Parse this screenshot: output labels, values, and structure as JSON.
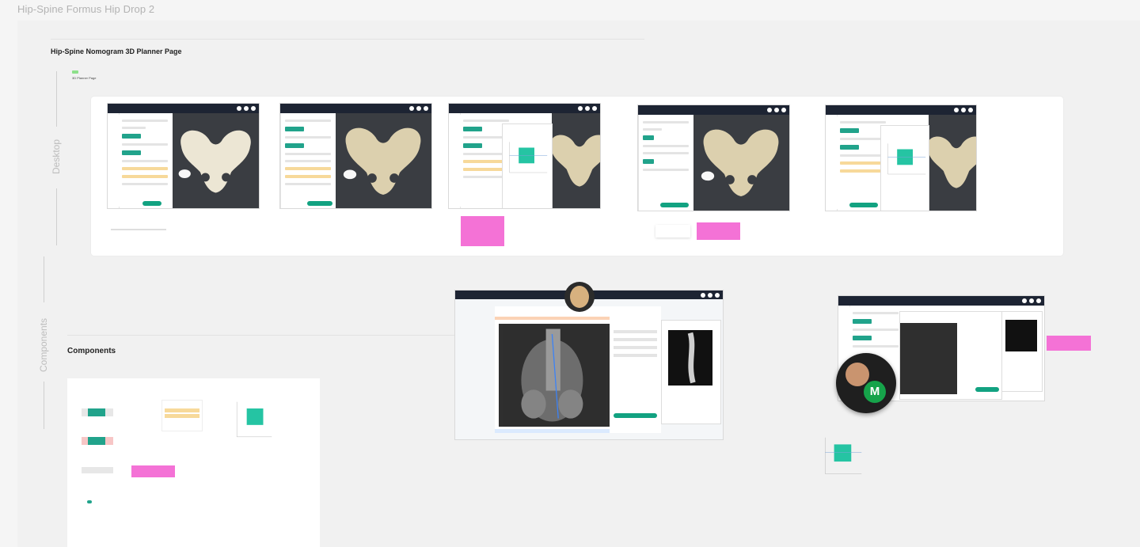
{
  "file": {
    "title": "Hip-Spine Formus Hip Drop 2"
  },
  "sections": {
    "main_heading": "Hip-Spine Nomogram 3D Planner Page",
    "tag_badge": "",
    "tag_label": "3D Planner Page",
    "desktop_label": "Desktop",
    "components_side_label": "Components",
    "components_heading": "Components"
  },
  "collaborator": {
    "initial": "M",
    "color": "#16a34a"
  },
  "colors": {
    "accent": "#12a281",
    "sticky": "#f472d6",
    "topbar": "#1d2433"
  },
  "icons": [
    "pelvis-model-icon",
    "xray-image-icon",
    "nomogram-chart-icon",
    "avatar-icon"
  ]
}
